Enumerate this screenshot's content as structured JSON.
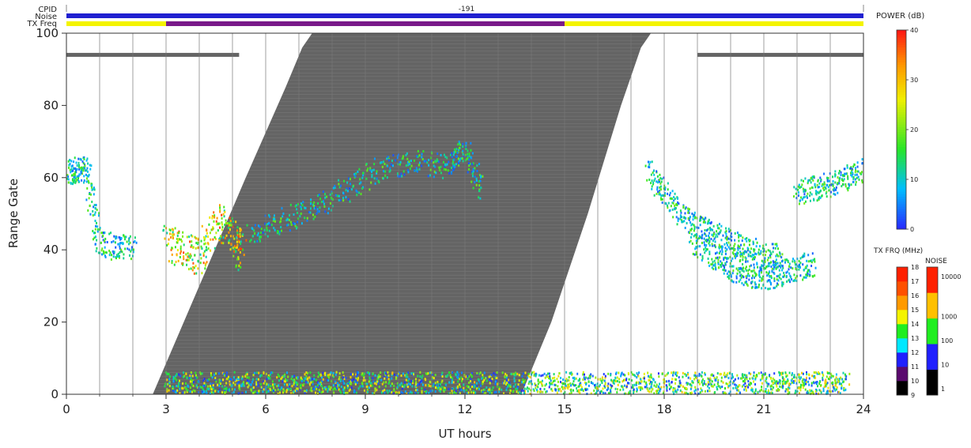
{
  "chart_data": {
    "type": "heatmap",
    "xlabel": "UT hours",
    "ylabel": "Range Gate",
    "xlim": [
      0,
      24
    ],
    "ylim": [
      0,
      100
    ],
    "x_ticks": [
      "0",
      "3",
      "6",
      "9",
      "12",
      "15",
      "18",
      "21",
      "24"
    ],
    "y_ticks": [
      "0",
      "20",
      "40",
      "60",
      "80",
      "100"
    ],
    "grid": "vertical lines every 1 UT hour",
    "header": {
      "cpid_label": "CPID",
      "noise_label": "Noise",
      "txfreq_label": "TX Freq",
      "cpid_value": "-191"
    },
    "power_scale": {
      "label": "POWER (dB)",
      "ticks": [
        "0",
        "10",
        "20",
        "30",
        "40"
      ],
      "min": 0,
      "max": 40
    },
    "txfreq_scale": {
      "label": "TX FRQ (MHz)",
      "ticks": [
        "9",
        "10",
        "11",
        "12",
        "13",
        "14",
        "15",
        "16",
        "17",
        "18"
      ],
      "colors": [
        "#000000",
        "#5a0a6e",
        "#2020ff",
        "#00e8ff",
        "#20ee20",
        "#f4f400",
        "#ff9a00",
        "#ff5000",
        "#ff2000"
      ]
    },
    "noise_scale": {
      "label": "NOISE",
      "ticks": [
        "1",
        "10",
        "100",
        "1000",
        "10000"
      ],
      "colors": [
        "#000000",
        "#2020ff",
        "#20ee20",
        "#ffc000",
        "#ff2000"
      ]
    },
    "ground_scatter_band": {
      "lower_left_edge": [
        [
          2.6,
          0
        ],
        [
          4.0,
          30
        ],
        [
          5.4,
          60
        ],
        [
          6.6,
          85
        ],
        [
          7.1,
          96
        ],
        [
          7.4,
          100
        ]
      ],
      "lower_right_edge": [
        [
          13.7,
          0
        ],
        [
          14.6,
          20
        ],
        [
          15.7,
          50
        ],
        [
          16.7,
          80
        ],
        [
          17.3,
          96
        ],
        [
          17.6,
          100
        ]
      ],
      "color": "#646464"
    },
    "gray_bars": [
      {
        "x_start": 0.0,
        "x_end": 5.2,
        "gate": 94
      },
      {
        "x_start": 19.0,
        "x_end": 24.0,
        "gate": 94
      }
    ],
    "header_strips": {
      "noise_color": "#2020d0",
      "txfreq_base_color": "#f4f400",
      "txfreq_segment": {
        "x_start": 3.0,
        "x_end": 15.0,
        "color": "#7a1a8a"
      }
    },
    "scatter_regions": [
      {
        "name": "midday-ionospheric",
        "points": [
          [
            5.5,
            44
          ],
          [
            6.5,
            48
          ],
          [
            7.5,
            52
          ],
          [
            8.5,
            57
          ],
          [
            9.5,
            63
          ],
          [
            10.5,
            64
          ],
          [
            11.5,
            63
          ],
          [
            12.0,
            68
          ],
          [
            12.5,
            56
          ]
        ]
      },
      {
        "name": "morning-strong",
        "points": [
          [
            3.0,
            42
          ],
          [
            3.5,
            40
          ],
          [
            4.0,
            38
          ],
          [
            4.5,
            48
          ],
          [
            5.0,
            44
          ],
          [
            5.3,
            38
          ]
        ]
      },
      {
        "name": "evening-arc",
        "points": [
          [
            17.5,
            62
          ],
          [
            18.0,
            55
          ],
          [
            18.5,
            49
          ],
          [
            19.0,
            46
          ],
          [
            19.5,
            44
          ],
          [
            20.0,
            42
          ],
          [
            20.5,
            40
          ],
          [
            21.0,
            38
          ],
          [
            21.5,
            38
          ]
        ]
      },
      {
        "name": "evening-lower-arc",
        "points": [
          [
            18.8,
            42
          ],
          [
            19.5,
            38
          ],
          [
            20.0,
            35
          ],
          [
            20.5,
            33
          ],
          [
            21.0,
            32
          ],
          [
            21.5,
            33
          ],
          [
            22.0,
            35
          ],
          [
            22.5,
            36
          ]
        ]
      },
      {
        "name": "late-evening",
        "points": [
          [
            22.0,
            55
          ],
          [
            22.5,
            57
          ],
          [
            23.0,
            58
          ],
          [
            23.5,
            60
          ],
          [
            24.0,
            62
          ]
        ]
      },
      {
        "name": "early-morning",
        "points": [
          [
            0.0,
            61
          ],
          [
            0.3,
            62
          ],
          [
            0.6,
            62
          ],
          [
            0.9,
            43
          ],
          [
            1.5,
            40
          ],
          [
            2.0,
            41
          ]
        ]
      },
      {
        "name": "near-ground",
        "points": [
          [
            3.0,
            2
          ],
          [
            6.0,
            3
          ],
          [
            9.0,
            3
          ],
          [
            12.0,
            3
          ],
          [
            15.0,
            4
          ],
          [
            18.0,
            4
          ],
          [
            21.0,
            3
          ],
          [
            23.5,
            3
          ]
        ]
      }
    ]
  }
}
